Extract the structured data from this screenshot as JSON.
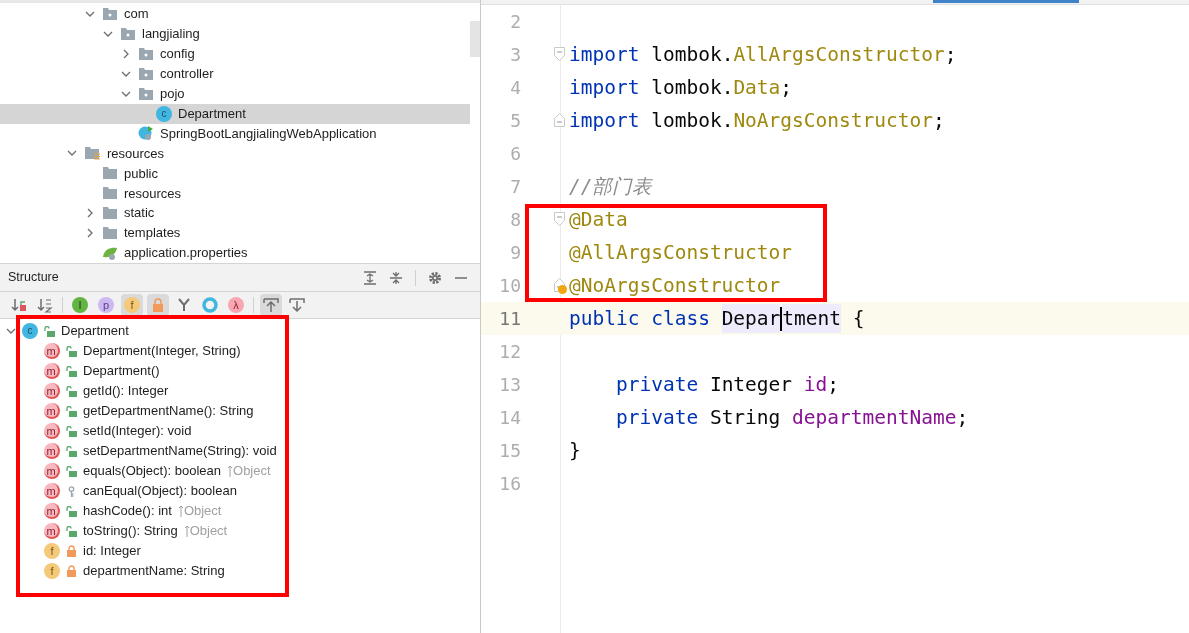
{
  "project_tree": {
    "inner_items": [
      {
        "label": "com",
        "kind": "package",
        "expanded": true,
        "selected": false,
        "children": [
          {
            "label": "langjialing",
            "kind": "package",
            "expanded": true,
            "selected": false,
            "children": [
              {
                "label": "config",
                "kind": "package",
                "expanded": false,
                "selected": false
              },
              {
                "label": "controller",
                "kind": "package",
                "expanded": true,
                "selected": false
              },
              {
                "label": "pojo",
                "kind": "package",
                "expanded": true,
                "selected": false,
                "children": [
                  {
                    "label": "Department",
                    "kind": "class",
                    "selected": true,
                    "glyph": "c"
                  }
                ]
              },
              {
                "label": "SpringBootLangjialingWebApplication",
                "kind": "app-class",
                "selected": false
              }
            ]
          }
        ]
      }
    ],
    "items": [
      {
        "label": "resources",
        "kind": "resources-root",
        "expanded": true,
        "selected": false,
        "children": [
          {
            "label": "public",
            "kind": "folder",
            "selected": false
          },
          {
            "label": "resources",
            "kind": "folder",
            "selected": false
          },
          {
            "label": "static",
            "kind": "folder",
            "expanded": false,
            "selected": false
          },
          {
            "label": "templates",
            "kind": "folder",
            "expanded": false,
            "selected": false
          },
          {
            "label": "application.properties",
            "kind": "properties",
            "selected": false
          }
        ]
      }
    ]
  },
  "structure": {
    "title": "Structure",
    "toolbar": [
      {
        "kind": "sort-visibility",
        "selected": false
      },
      {
        "kind": "sort-alpha",
        "selected": false
      },
      {
        "kind": "inherited",
        "selected": false,
        "glyph": "I"
      },
      {
        "kind": "properties",
        "selected": false,
        "glyph": "p"
      },
      {
        "kind": "fields",
        "selected": true,
        "glyph": "f"
      },
      {
        "kind": "non-public",
        "selected": true
      },
      {
        "kind": "merge",
        "selected": false
      },
      {
        "kind": "anonymous",
        "selected": false
      },
      {
        "kind": "lambdas",
        "selected": false,
        "glyph": "λ"
      },
      {
        "kind": "autoscroll-to",
        "selected": true
      },
      {
        "kind": "autoscroll-from",
        "selected": false
      }
    ],
    "root": {
      "label": "Department",
      "glyph": "c",
      "expanded": true,
      "children": [
        {
          "label": "Department(Integer, String)",
          "kind": "public-method",
          "glyph": "m"
        },
        {
          "label": "Department()",
          "kind": "public-method",
          "glyph": "m"
        },
        {
          "label": "getId(): Integer",
          "kind": "public-method",
          "glyph": "m"
        },
        {
          "label": "getDepartmentName(): String",
          "kind": "public-method",
          "glyph": "m"
        },
        {
          "label": "setId(Integer): void",
          "kind": "public-method",
          "glyph": "m"
        },
        {
          "label": "setDepartmentName(String): void",
          "kind": "public-method",
          "glyph": "m"
        },
        {
          "label": "equals(Object): boolean",
          "kind": "public-method",
          "glyph": "m",
          "inherited_from": "Object"
        },
        {
          "label": "canEqual(Object): boolean",
          "kind": "protected-method",
          "glyph": "m"
        },
        {
          "label": "hashCode(): int",
          "kind": "public-method",
          "glyph": "m",
          "inherited_from": "Object"
        },
        {
          "label": "toString(): String",
          "kind": "public-method",
          "glyph": "m",
          "inherited_from": "Object"
        },
        {
          "label": "id: Integer",
          "kind": "private-field",
          "glyph": "f"
        },
        {
          "label": "departmentName: String",
          "kind": "private-field",
          "glyph": "f"
        }
      ]
    }
  },
  "editor": {
    "lines": [
      {
        "number": "2",
        "current": false
      },
      {
        "number": "3",
        "current": false,
        "fold_start": true,
        "tokens": [
          {
            "text": "import",
            "kind": "keyword"
          },
          {
            "text": " lombok.",
            "kind": "plain"
          },
          {
            "text": "AllArgsConstructor",
            "kind": "annotation"
          },
          {
            "text": ";",
            "kind": "plain"
          }
        ]
      },
      {
        "number": "4",
        "current": false,
        "tokens": [
          {
            "text": "import",
            "kind": "keyword"
          },
          {
            "text": " lombok.",
            "kind": "plain"
          },
          {
            "text": "Data",
            "kind": "annotation"
          },
          {
            "text": ";",
            "kind": "plain"
          }
        ]
      },
      {
        "number": "5",
        "current": false,
        "fold_end": true,
        "tokens": [
          {
            "text": "import",
            "kind": "keyword"
          },
          {
            "text": " lombok.",
            "kind": "plain"
          },
          {
            "text": "NoArgsConstructor",
            "kind": "annotation"
          },
          {
            "text": ";",
            "kind": "plain"
          }
        ]
      },
      {
        "number": "6",
        "current": false
      },
      {
        "number": "7",
        "current": false,
        "tokens": [
          {
            "text": "//部门表",
            "kind": "comment"
          }
        ]
      },
      {
        "number": "8",
        "current": false,
        "fold_start": true,
        "tokens": [
          {
            "text": "@Data",
            "kind": "annotation"
          }
        ]
      },
      {
        "number": "9",
        "current": false,
        "tokens": [
          {
            "text": "@AllArgsConstructor",
            "kind": "annotation"
          }
        ]
      },
      {
        "number": "10",
        "current": false,
        "fold_end": true,
        "tokens": [
          {
            "text": "@NoArgsConstructor",
            "kind": "annotation"
          }
        ]
      },
      {
        "number": "11",
        "current": true,
        "tokens": [
          {
            "text": "public class ",
            "kind": "keyword"
          },
          {
            "text": "Depar",
            "kind": "usage"
          },
          {
            "text": "tment",
            "kind": "usage",
            "caret_before": true
          },
          {
            "text": " {",
            "kind": "plain"
          }
        ]
      },
      {
        "number": "12",
        "current": false
      },
      {
        "number": "13",
        "current": false,
        "tokens": [
          {
            "text": "    private ",
            "kind": "keyword"
          },
          {
            "text": "Integer ",
            "kind": "plain"
          },
          {
            "text": "id",
            "kind": "field"
          },
          {
            "text": ";",
            "kind": "plain"
          }
        ]
      },
      {
        "number": "14",
        "current": false,
        "tokens": [
          {
            "text": "    private ",
            "kind": "keyword"
          },
          {
            "text": "String ",
            "kind": "plain"
          },
          {
            "text": "departmentName",
            "kind": "field"
          },
          {
            "text": ";",
            "kind": "plain"
          }
        ]
      },
      {
        "number": "15",
        "current": false,
        "tokens": [
          {
            "text": "}",
            "kind": "plain"
          }
        ]
      },
      {
        "number": "16",
        "current": false
      }
    ]
  }
}
